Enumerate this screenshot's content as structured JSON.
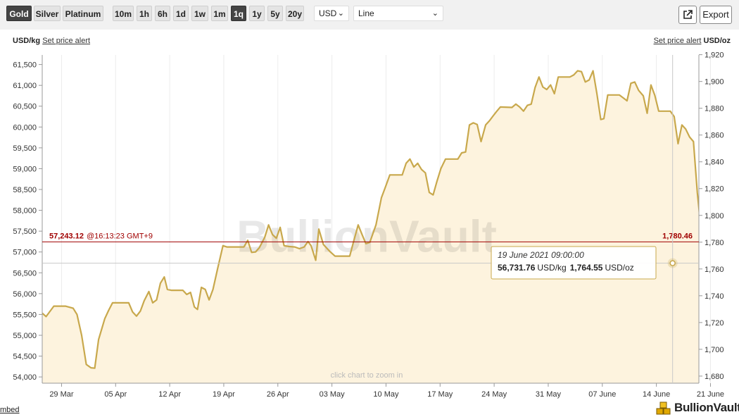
{
  "toolbar": {
    "metals": [
      {
        "label": "Gold",
        "active": true
      },
      {
        "label": "Silver",
        "active": false
      },
      {
        "label": "Platinum",
        "active": false
      }
    ],
    "ranges": [
      {
        "label": "10m",
        "active": false
      },
      {
        "label": "1h",
        "active": false
      },
      {
        "label": "6h",
        "active": false
      },
      {
        "label": "1d",
        "active": false
      },
      {
        "label": "1w",
        "active": false
      },
      {
        "label": "1m",
        "active": false
      },
      {
        "label": "1q",
        "active": true
      },
      {
        "label": "1y",
        "active": false
      },
      {
        "label": "5y",
        "active": false
      },
      {
        "label": "20y",
        "active": false
      }
    ],
    "currency": "USD",
    "chart_type": "Line",
    "export_label": "Export"
  },
  "header": {
    "left_unit": "USD/kg",
    "left_alert": "Set price alert",
    "right_alert": "Set price alert",
    "right_unit": "USD/oz"
  },
  "footer": {
    "embed": "mbed",
    "logo": "BullionVault"
  },
  "colors": {
    "line": "#c8a84c",
    "fill": "#fdf3de",
    "current_line": "#a00000",
    "tooltip_border": "#c8a84c"
  },
  "chart_data": {
    "type": "area",
    "watermark": "BullionVault",
    "hint": "click chart to zoom in",
    "x_ticks": [
      "29 Mar",
      "05 Apr",
      "12 Apr",
      "19 Apr",
      "26 Apr",
      "03 May",
      "10 May",
      "17 May",
      "24 May",
      "31 May",
      "07 June",
      "14 June",
      "21 June"
    ],
    "y_left": {
      "label": "USD/kg",
      "ticks": [
        "61,500",
        "61,000",
        "60,500",
        "60,000",
        "59,500",
        "59,000",
        "58,500",
        "58,000",
        "57,500",
        "57,000",
        "56,500",
        "56,000",
        "55,500",
        "55,000",
        "54,500",
        "54,000"
      ],
      "ylim": [
        53850,
        61730
      ]
    },
    "y_right": {
      "label": "USD/oz",
      "ticks": [
        "1,920",
        "1,900",
        "1,880",
        "1,860",
        "1,840",
        "1,820",
        "1,800",
        "1,780",
        "1,760",
        "1,740",
        "1,720",
        "1,700",
        "1,680"
      ],
      "ylim": [
        1674.7,
        1919.8
      ]
    },
    "x_range_days": [
      -2.5,
      82.5
    ],
    "current": {
      "value_kg": "57,243.12",
      "time": "@16:13:23 GMT+9",
      "value_oz": "1,780.46",
      "kg": 57243
    },
    "tooltip": {
      "date": "19 June 2021 09:00:00",
      "kg": "56,731.76",
      "kg_unit": "USD/kg",
      "oz": "1,764.55",
      "oz_unit": "USD/oz",
      "day": 79.1,
      "kg_value": 56732
    },
    "series": [
      {
        "unit": "USD/kg",
        "points": [
          [
            -2.5,
            55530
          ],
          [
            -2,
            55450
          ],
          [
            -1,
            55700
          ],
          [
            0.5,
            55700
          ],
          [
            1.5,
            55650
          ],
          [
            2,
            55500
          ],
          [
            2.6,
            55000
          ],
          [
            3.2,
            54300
          ],
          [
            3.8,
            54220
          ],
          [
            4.3,
            54210
          ],
          [
            4.8,
            54900
          ],
          [
            5.6,
            55400
          ],
          [
            6.1,
            55600
          ],
          [
            6.6,
            55780
          ],
          [
            8.2,
            55780
          ],
          [
            8.7,
            55780
          ],
          [
            9.2,
            55560
          ],
          [
            9.7,
            55460
          ],
          [
            10.2,
            55580
          ],
          [
            10.7,
            55830
          ],
          [
            11.3,
            56050
          ],
          [
            11.8,
            55780
          ],
          [
            12.3,
            55850
          ],
          [
            12.8,
            56250
          ],
          [
            13.3,
            56400
          ],
          [
            13.7,
            56100
          ],
          [
            14.2,
            56080
          ],
          [
            15.7,
            56080
          ],
          [
            16.2,
            55980
          ],
          [
            16.7,
            56030
          ],
          [
            17.2,
            55680
          ],
          [
            17.6,
            55620
          ],
          [
            18.1,
            56150
          ],
          [
            18.6,
            56100
          ],
          [
            19.1,
            55850
          ],
          [
            19.6,
            56100
          ],
          [
            20.2,
            56600
          ],
          [
            20.9,
            57150
          ],
          [
            21.4,
            57120
          ],
          [
            23.6,
            57120
          ],
          [
            24.1,
            57280
          ],
          [
            24.6,
            56990
          ],
          [
            25.1,
            57000
          ],
          [
            25.6,
            57100
          ],
          [
            26.3,
            57350
          ],
          [
            26.8,
            57650
          ],
          [
            27.3,
            57420
          ],
          [
            27.8,
            57330
          ],
          [
            28.3,
            57590
          ],
          [
            28.8,
            57150
          ],
          [
            29.5,
            57130
          ],
          [
            30.2,
            57120
          ],
          [
            30.8,
            57080
          ],
          [
            31.4,
            57120
          ],
          [
            31.9,
            57250
          ],
          [
            32.3,
            57150
          ],
          [
            32.9,
            56800
          ],
          [
            33.3,
            57550
          ],
          [
            33.9,
            57180
          ],
          [
            34.8,
            57000
          ],
          [
            35.4,
            56900
          ],
          [
            37.3,
            56900
          ],
          [
            37.8,
            57250
          ],
          [
            38.4,
            57650
          ],
          [
            38.9,
            57420
          ],
          [
            39.4,
            57200
          ],
          [
            39.9,
            57230
          ],
          [
            40.7,
            57650
          ],
          [
            41.4,
            58300
          ],
          [
            41.9,
            58550
          ],
          [
            42.5,
            58850
          ],
          [
            44.1,
            58850
          ],
          [
            44.6,
            59130
          ],
          [
            45.1,
            59230
          ],
          [
            45.6,
            59040
          ],
          [
            46.1,
            59130
          ],
          [
            46.6,
            58980
          ],
          [
            47.1,
            58900
          ],
          [
            47.6,
            58430
          ],
          [
            48.1,
            58370
          ],
          [
            48.6,
            58700
          ],
          [
            49.1,
            59000
          ],
          [
            49.7,
            59230
          ],
          [
            51.3,
            59230
          ],
          [
            51.8,
            59380
          ],
          [
            52.3,
            59400
          ],
          [
            52.8,
            60050
          ],
          [
            53.3,
            60100
          ],
          [
            53.8,
            60060
          ],
          [
            54.3,
            59650
          ],
          [
            54.9,
            60050
          ],
          [
            55.4,
            60150
          ],
          [
            55.8,
            60250
          ],
          [
            56.3,
            60370
          ],
          [
            56.8,
            60480
          ],
          [
            58.3,
            60470
          ],
          [
            58.8,
            60550
          ],
          [
            59.3,
            60480
          ],
          [
            59.8,
            60380
          ],
          [
            60.3,
            60520
          ],
          [
            60.8,
            60550
          ],
          [
            61.3,
            60950
          ],
          [
            61.8,
            61200
          ],
          [
            62.3,
            60960
          ],
          [
            62.8,
            60900
          ],
          [
            63.3,
            61010
          ],
          [
            63.8,
            60800
          ],
          [
            64.3,
            61200
          ],
          [
            65.8,
            61200
          ],
          [
            66.3,
            61250
          ],
          [
            66.8,
            61350
          ],
          [
            67.3,
            61330
          ],
          [
            67.8,
            61080
          ],
          [
            68.3,
            61130
          ],
          [
            68.8,
            61350
          ],
          [
            69.3,
            60800
          ],
          [
            69.8,
            60180
          ],
          [
            70.2,
            60200
          ],
          [
            70.7,
            60770
          ],
          [
            72.2,
            60770
          ],
          [
            72.7,
            60700
          ],
          [
            73.2,
            60630
          ],
          [
            73.7,
            61050
          ],
          [
            74.2,
            61080
          ],
          [
            74.7,
            60880
          ],
          [
            75.3,
            60750
          ],
          [
            75.8,
            60330
          ],
          [
            76.3,
            61010
          ],
          [
            76.8,
            60760
          ],
          [
            77.3,
            60380
          ],
          [
            78.8,
            60380
          ],
          [
            79.3,
            60250
          ],
          [
            79.8,
            59600
          ],
          [
            80.3,
            60050
          ],
          [
            80.8,
            59950
          ],
          [
            81.3,
            59760
          ],
          [
            81.8,
            59650
          ],
          [
            82.3,
            58420
          ],
          [
            82.8,
            57500
          ],
          [
            83.3,
            57180
          ],
          [
            83.6,
            57630
          ]
        ]
      }
    ]
  }
}
